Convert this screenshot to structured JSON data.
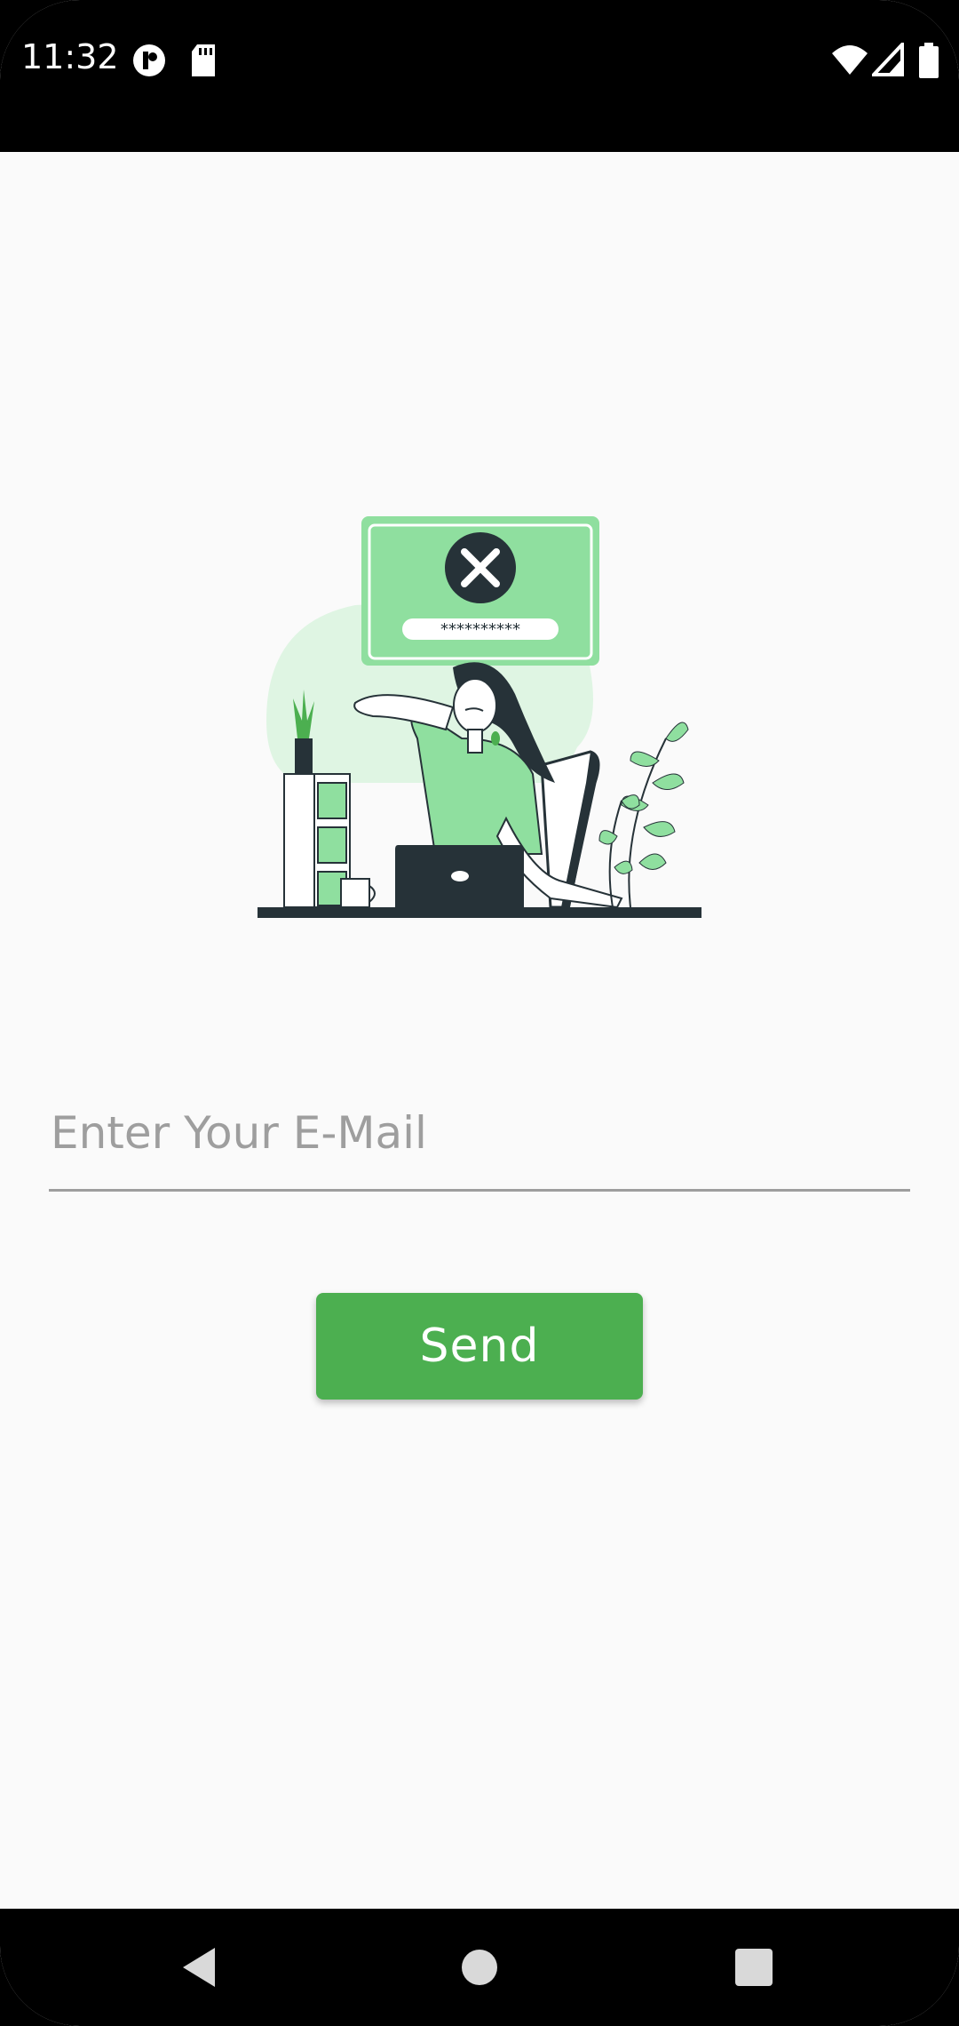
{
  "status_bar": {
    "time": "11:32",
    "icons": [
      "app-notification-icon",
      "sd-card-icon",
      "wifi-icon",
      "signal-icon",
      "battery-icon"
    ]
  },
  "illustration": {
    "semantic": "woman-forgot-password-illustration",
    "password_mask": "**********"
  },
  "form": {
    "email_placeholder": "Enter Your E-Mail",
    "email_value": "",
    "send_label": "Send"
  },
  "colors": {
    "accent": "#4caf50",
    "light_green": "#8fdf9f",
    "pale_green": "#dff5e3",
    "dark": "#263238"
  },
  "nav_bar": {
    "buttons": [
      "back-icon",
      "home-icon",
      "recents-icon"
    ]
  }
}
